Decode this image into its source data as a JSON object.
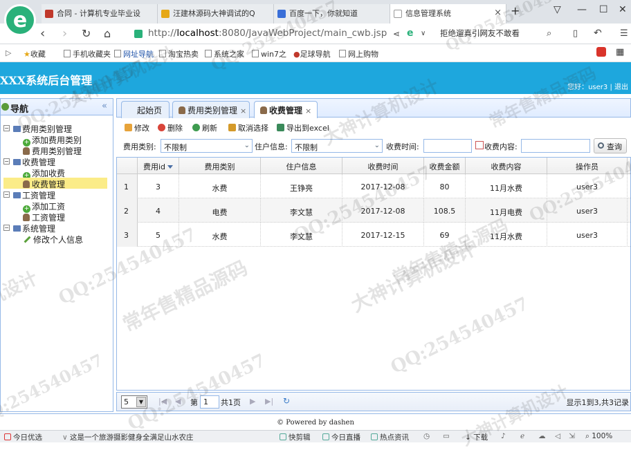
{
  "browser": {
    "tabs": [
      {
        "label": "合同 - 计算机专业毕业设",
        "color": "#c0392b"
      },
      {
        "label": "汪建林源码大神调试的Q",
        "color": "#e6a817"
      },
      {
        "label": "百度一下，你就知道",
        "color": "#3a6fd8"
      },
      {
        "label": "信息管理系统",
        "color": "#cccccc"
      }
    ],
    "new_tab": "+",
    "close_glyph": "×",
    "url_prefix": "http://",
    "url_host": "localhost",
    "url_rest": ":8080/JavaWebProject/main_cwb.jsp",
    "search_text": "拒绝遛真引网友不敢看",
    "bookmarks": [
      "收藏",
      "手机收藏夹",
      "网址导航",
      "淘宝热卖",
      "系统之家",
      "win7之",
      "足球导航",
      "网上购物"
    ]
  },
  "header": {
    "title": "XXX系统后台管理",
    "user_text": "您好：user3 | 退出"
  },
  "nav": {
    "title": "导航",
    "collapse": "«",
    "groups": [
      {
        "label": "费用类别管理",
        "items": [
          "添加费用类别",
          "费用类别管理"
        ]
      },
      {
        "label": "收费管理",
        "items": [
          "添加收费",
          "收费管理"
        ]
      },
      {
        "label": "工资管理",
        "items": [
          "添加工资",
          "工资管理"
        ]
      },
      {
        "label": "系统管理",
        "items": [
          "修改个人信息"
        ]
      }
    ]
  },
  "panel_tabs": [
    "起始页",
    "费用类别管理",
    "收费管理"
  ],
  "toolbar": {
    "edit": "修改",
    "delete": "删除",
    "refresh": "刷新",
    "cancel_select": "取消选择",
    "export": "导出到excel"
  },
  "filters": {
    "fee_type_label": "费用类别:",
    "fee_type_value": "不限制",
    "resident_label": "住户信息:",
    "resident_value": "不限制",
    "time_label": "收费时间:",
    "time_value": "",
    "content_label": "收费内容:",
    "content_value": "",
    "query": "查询"
  },
  "grid": {
    "columns": [
      "费用id",
      "费用类别",
      "住户信息",
      "收费时间",
      "收费金额",
      "收费内容",
      "操作员"
    ],
    "rows": [
      {
        "n": "1",
        "cells": [
          "3",
          "水费",
          "王铮亮",
          "2017-12-08",
          "80",
          "11月水费",
          "user3"
        ]
      },
      {
        "n": "2",
        "cells": [
          "4",
          "电费",
          "李文慧",
          "2017-12-08",
          "108.5",
          "11月电费",
          "user3"
        ]
      },
      {
        "n": "3",
        "cells": [
          "5",
          "水费",
          "李文慧",
          "2017-12-15",
          "69",
          "11月水费",
          "user3"
        ]
      }
    ]
  },
  "pager": {
    "page_size": "5",
    "page_prefix": "第",
    "page_value": "1",
    "page_total": "共1页",
    "summary": "显示1到3,共3记录"
  },
  "footer": "© Powered by dashen",
  "statusbar": [
    "今日优选",
    "这是一个旅游摄影健身全满足山水农庄",
    "快剪辑",
    "今日直播",
    "热点资讯",
    "下载",
    "100%"
  ],
  "watermark": {
    "qq": "QQ:254540457",
    "sell": "常年售精品源码",
    "design": "大神计算机设计"
  }
}
